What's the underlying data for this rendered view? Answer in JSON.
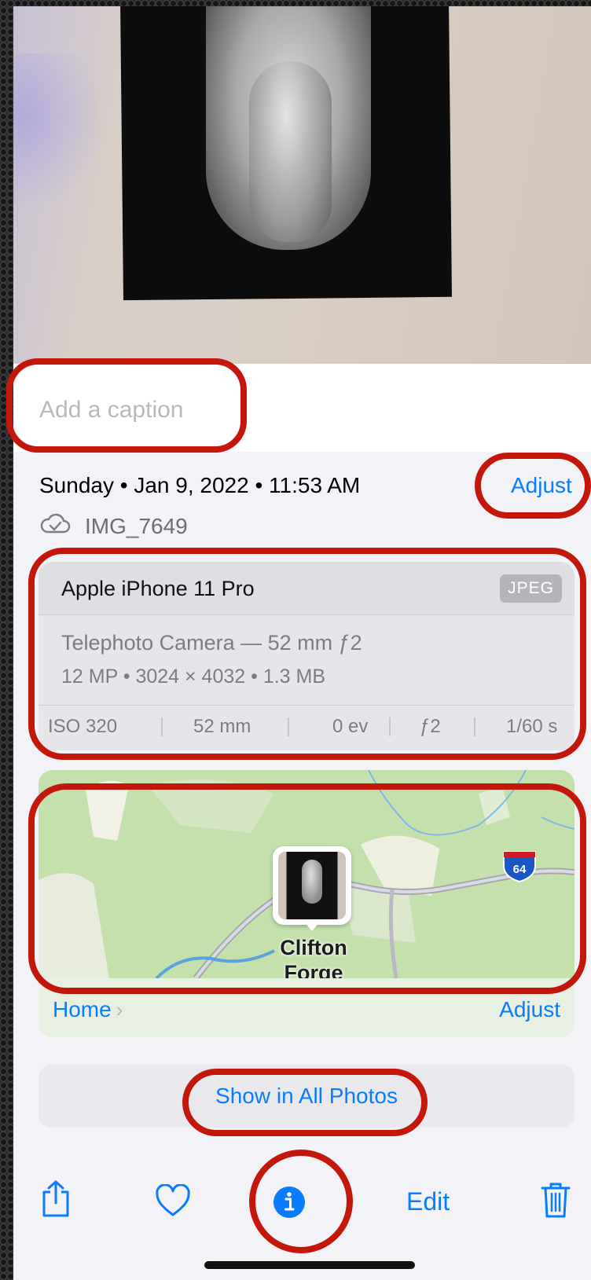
{
  "caption": {
    "placeholder": "Add a caption"
  },
  "metadata": {
    "date_time": "Sunday • Jan 9, 2022 • 11:53 AM",
    "adjust_label": "Adjust",
    "filename": "IMG_7649",
    "cloud_icon": "icloud-check-icon"
  },
  "camera": {
    "model": "Apple iPhone 11 Pro",
    "format_badge": "JPEG",
    "lens": "Telephoto Camera — 52 mm ƒ2",
    "specs": "12 MP  •  3024 × 4032  •  1.3 MB",
    "exif": {
      "iso": "ISO 320",
      "focal": "52 mm",
      "ev": "0 ev",
      "aperture": "ƒ2",
      "shutter": "1/60 s"
    }
  },
  "map": {
    "place_line1": "Clifton",
    "place_line2": "Forge",
    "shield": "64",
    "location_link": "Home",
    "adjust_label": "Adjust"
  },
  "show_all_label": "Show in All Photos",
  "toolbar": {
    "share_icon": "share-icon",
    "favorite_icon": "heart-icon",
    "info_icon": "info-icon",
    "edit_label": "Edit",
    "delete_icon": "trash-icon"
  },
  "colors": {
    "accent": "#0a7cff",
    "annotation": "#c4170c",
    "background": "#f2f2f7"
  }
}
